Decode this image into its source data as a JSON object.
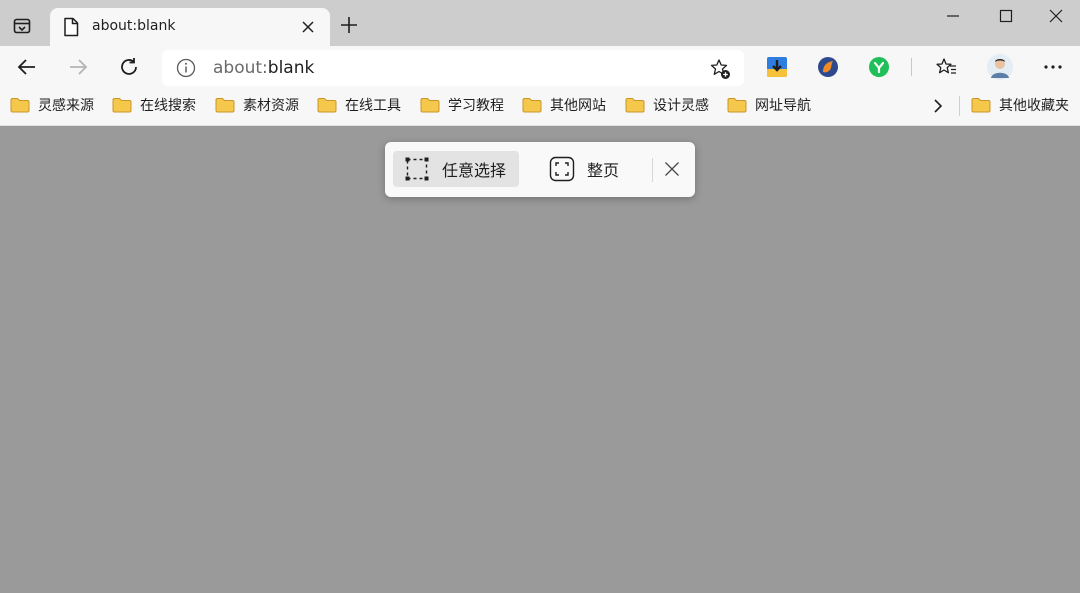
{
  "tab": {
    "title": "about:blank",
    "favicon": "page-icon"
  },
  "address_bar": {
    "url_prefix": "about:",
    "url_main": "blank",
    "info_icon": "info-icon",
    "favorite_icon": "add-favorite-icon"
  },
  "nav": {
    "back": "back-arrow-icon",
    "forward": "forward-arrow-icon",
    "refresh": "refresh-icon"
  },
  "extensions": [
    "download-extension-icon",
    "fox-extension-icon",
    "green-y-extension-icon"
  ],
  "toolbar_right": {
    "favorites": "favorites-icon",
    "profile": "profile-avatar",
    "more": "more-icon"
  },
  "bookmarks": {
    "items": [
      {
        "label": "灵感来源"
      },
      {
        "label": "在线搜索"
      },
      {
        "label": "素材资源"
      },
      {
        "label": "在线工具"
      },
      {
        "label": "学习教程"
      },
      {
        "label": "其他网站"
      },
      {
        "label": "设计灵感"
      },
      {
        "label": "网址导航"
      }
    ],
    "other_label": "其他收藏夹"
  },
  "capture": {
    "free_select_label": "任意选择",
    "full_page_label": "整页"
  },
  "colors": {
    "folder": "#f5c84c",
    "page_bg": "#9a9a9a",
    "chrome_bg": "#cdcdcd",
    "toolbar_bg": "#f7f7f7"
  }
}
